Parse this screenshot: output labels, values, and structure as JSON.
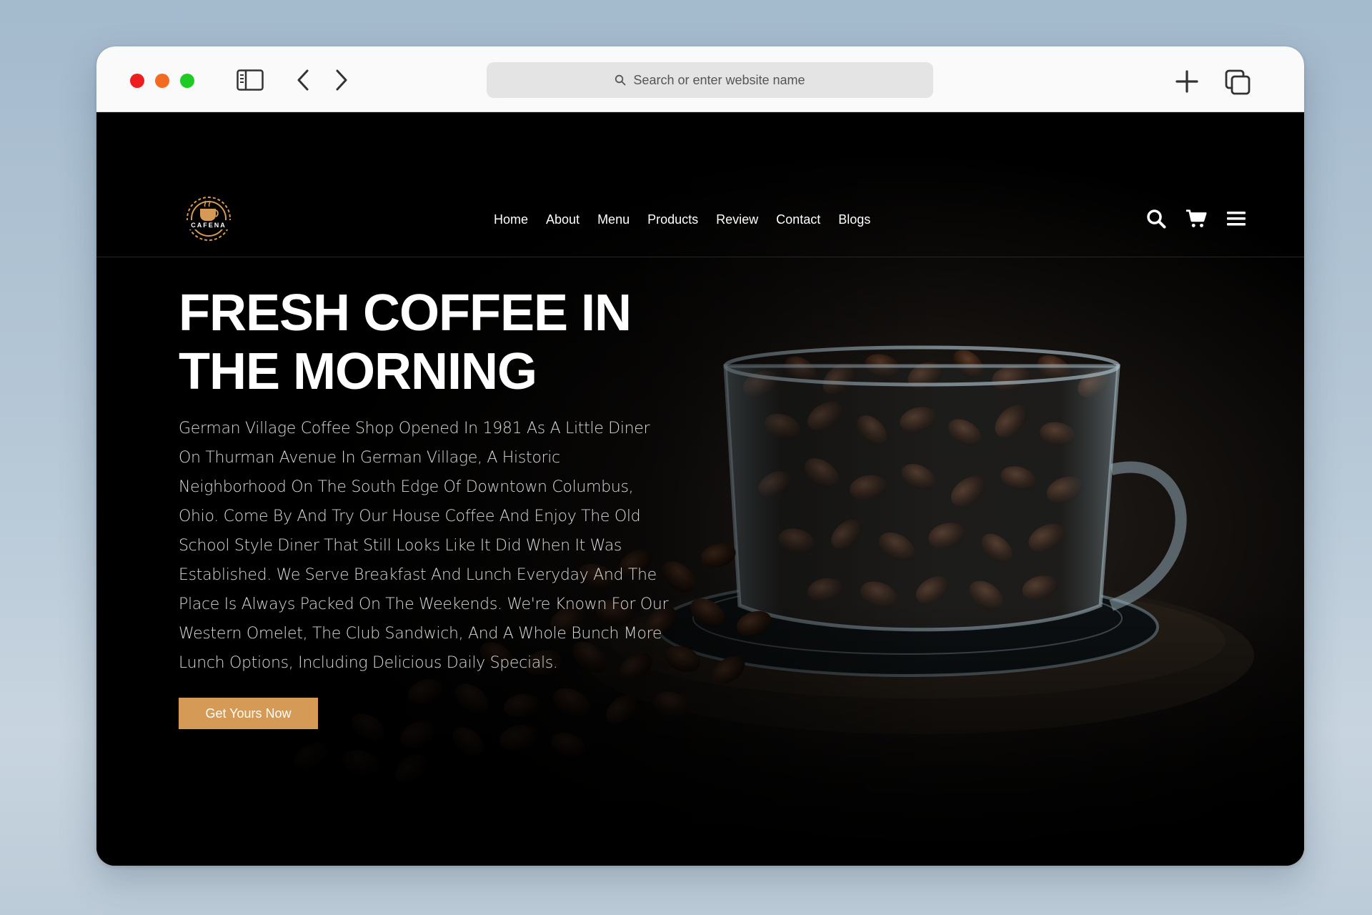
{
  "browser": {
    "address_placeholder": "Search or enter website name"
  },
  "site": {
    "logo_text": "CAFENA",
    "nav": [
      {
        "label": "Home"
      },
      {
        "label": "About"
      },
      {
        "label": "Menu"
      },
      {
        "label": "Products"
      },
      {
        "label": "Review"
      },
      {
        "label": "Contact"
      },
      {
        "label": "Blogs"
      }
    ],
    "icons": [
      "search-icon",
      "cart-icon",
      "menu-icon"
    ],
    "hero": {
      "title_line1": "FRESH COFFEE IN",
      "title_line2": "THE MORNING",
      "body": "German Village Coffee Shop Opened In 1981 As A Little Diner On Thurman Avenue In German Village, A Historic Neighborhood On The South Edge Of Downtown Columbus, Ohio. Come By And Try Our House Coffee And Enjoy The Old School Style Diner That Still Looks Like It Did When It Was Established. We Serve Breakfast And Lunch Everyday And The Place Is Always Packed On The Weekends. We're Known For Our Western Omelet, The Club Sandwich, And A Whole Bunch More Lunch Options, Including Delicious Daily Specials.",
      "cta_label": "Get Yours Now"
    }
  },
  "colors": {
    "accent": "#d59a55",
    "background": "#000000",
    "traffic_red": "#ee1e1e",
    "traffic_orange": "#f26b21",
    "traffic_green": "#1ecb25"
  }
}
